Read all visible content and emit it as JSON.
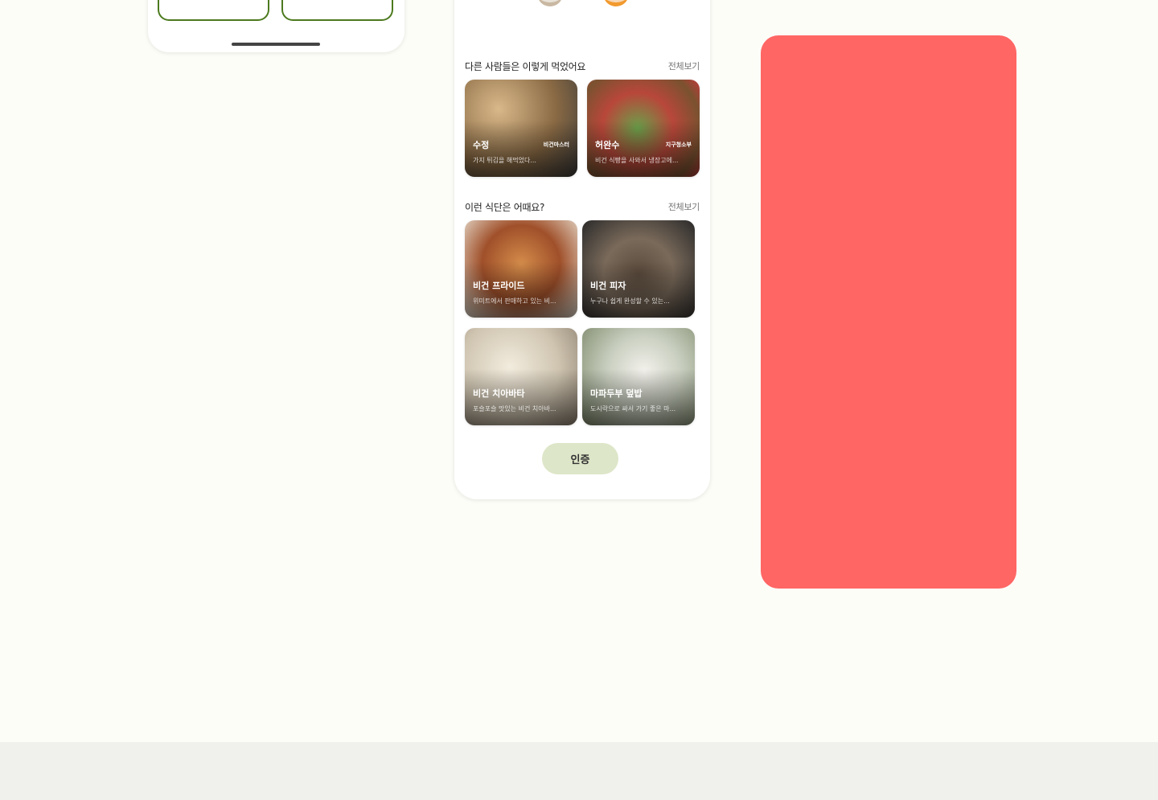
{
  "colors": {
    "background": "#fdfdf8",
    "footer_band": "#f0f0ec",
    "accent_green": "#4c7a1e",
    "verify_button_bg": "#dde6c8",
    "red_panel": "#ff6664"
  },
  "left_screen": {
    "buttons": [
      {
        "label": ""
      },
      {
        "label": ""
      }
    ]
  },
  "middle_screen": {
    "top_icons": [
      "bowl-icon",
      "food-icon"
    ],
    "others_section": {
      "title": "다른 사람들은 이렇게 먹었어요",
      "see_all": "전체보기",
      "posts": [
        {
          "user": "수정",
          "badge": "비건마스터",
          "text": "가지 튀김을 해먹었다..."
        },
        {
          "user": "허완수",
          "badge": "지구청소부",
          "text": "비건 식빵을 사와서 냉장고에..."
        }
      ]
    },
    "suggest_section": {
      "title": "이런 식단은 어때요?",
      "see_all": "전체보기",
      "meals": [
        {
          "name": "비건 프라이드",
          "desc": "위미트에서 판매하고 있는 비..."
        },
        {
          "name": "비건 피자",
          "desc": "누구나 쉽게 완성할 수 있는..."
        },
        {
          "name": "비건 치아바타",
          "desc": "포슬포슬 맛있는 비건 치아바..."
        },
        {
          "name": "마파두부 덮밥",
          "desc": "도시락으로 싸서 가기 좋은 마..."
        }
      ]
    },
    "verify_button": "인증"
  }
}
